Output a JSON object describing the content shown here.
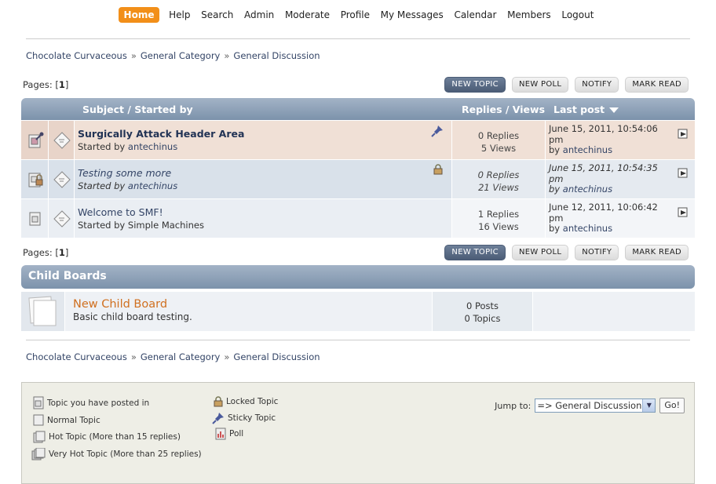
{
  "nav": [
    "Home",
    "Help",
    "Search",
    "Admin",
    "Moderate",
    "Profile",
    "My Messages",
    "Calendar",
    "Members",
    "Logout"
  ],
  "breadcrumb": [
    "Chocolate Curvaceous",
    "General Category",
    "General Discussion"
  ],
  "breadcrumb_sep": "»",
  "pages_label": "Pages: [",
  "pages_current": "1",
  "pages_close": "]",
  "buttons": {
    "new_topic": "NEW TOPIC",
    "new_poll": "NEW POLL",
    "notify": "NOTIFY",
    "mark_read": "MARK READ"
  },
  "table": {
    "subject_header": "Subject / Started by",
    "stats_header": "Replies / Views",
    "last_header": "Last post"
  },
  "topics": [
    {
      "title": "Surgically Attack Header Area",
      "started_by": "Started by",
      "author": "antechinus",
      "replies": "0 Replies",
      "views": "5 Views",
      "last_date": "June 15, 2011, 10:54:06 pm",
      "last_by": "by",
      "last_author": "antechinus"
    },
    {
      "title": "Testing some more",
      "started_by": "Started by",
      "author": "antechinus",
      "replies": "0 Replies",
      "views": "21 Views",
      "last_date": "June 15, 2011, 10:54:35 pm",
      "last_by": "by",
      "last_author": "antechinus"
    },
    {
      "title": "Welcome to SMF!",
      "started_by": "Started by",
      "author": "Simple Machines",
      "replies": "1 Replies",
      "views": "16 Views",
      "last_date": "June 12, 2011, 10:06:42 pm",
      "last_by": "by",
      "last_author": "antechinus"
    }
  ],
  "child_boards": {
    "header": "Child Boards",
    "name": "New Child Board",
    "description": "Basic child board testing.",
    "posts": "0 Posts",
    "topics": "0 Topics"
  },
  "legend": {
    "posted": "Topic you have posted in",
    "normal": "Normal Topic",
    "hot": "Hot Topic (More than 15 replies)",
    "very_hot": "Very Hot Topic (More than 25 replies)",
    "locked": "Locked Topic",
    "sticky": "Sticky Topic",
    "poll": "Poll"
  },
  "jump": {
    "label": "Jump to:",
    "selected": "=> General Discussion",
    "go": "Go!"
  },
  "colors": {
    "home_tab": "#f28f19",
    "header_gradient_top": "#a3b3c6",
    "header_gradient_bottom": "#7c92ab",
    "child_board_link": "#d07020"
  }
}
